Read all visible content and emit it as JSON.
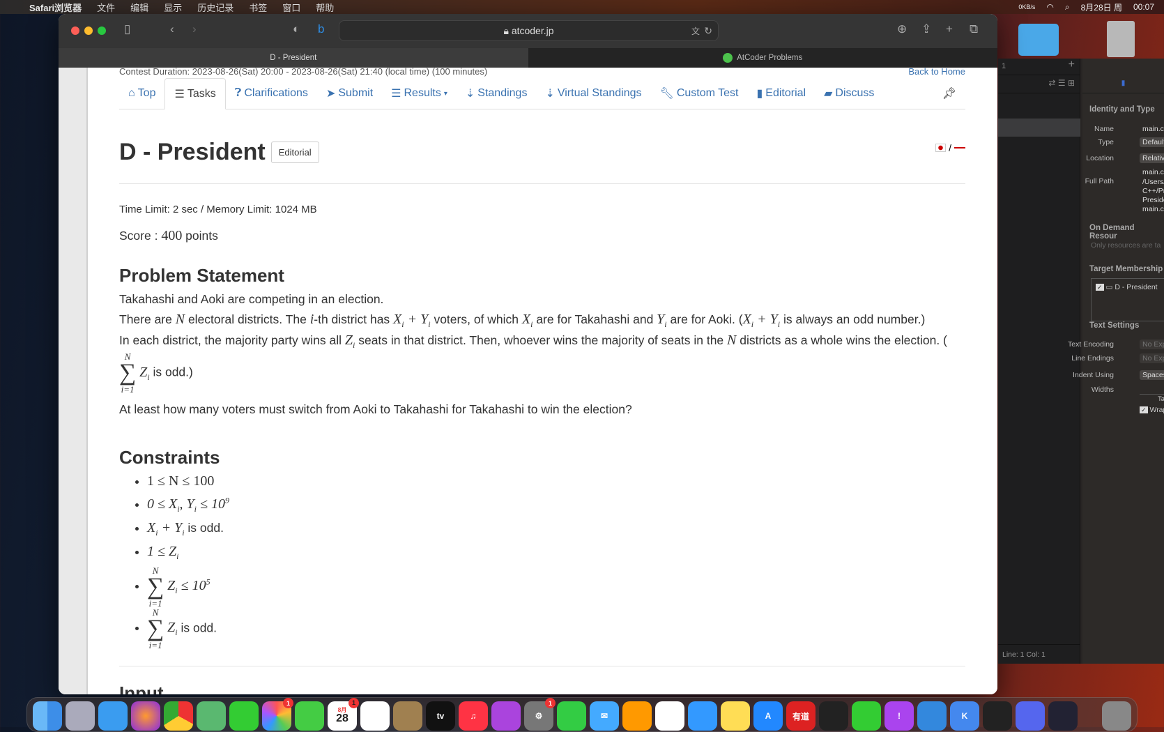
{
  "menubar": {
    "app": "Safari浏览器",
    "items": [
      "文件",
      "编辑",
      "显示",
      "历史记录",
      "书签",
      "窗口",
      "帮助"
    ],
    "net": "0KB/s",
    "date": "8月28日 周",
    "time": "00:07"
  },
  "browser": {
    "url": "atcoder.jp",
    "tabs": [
      {
        "title": "D - President",
        "active": true
      },
      {
        "title": "AtCoder Problems",
        "active": false
      }
    ]
  },
  "page": {
    "contest_duration": "Contest Duration: 2023-08-26(Sat) 20:00 - 2023-08-26(Sat) 21:40 (local time) (100 minutes)",
    "back_home": "Back to Home",
    "nav": [
      {
        "label": "Top",
        "icon": "home-icon"
      },
      {
        "label": "Tasks",
        "icon": "tasks-icon",
        "active": true
      },
      {
        "label": "Clarifications",
        "icon": "question-icon"
      },
      {
        "label": "Submit",
        "icon": "send-icon"
      },
      {
        "label": "Results",
        "icon": "list-icon",
        "dropdown": true
      },
      {
        "label": "Standings",
        "icon": "sort-icon"
      },
      {
        "label": "Virtual Standings",
        "icon": "sort-icon"
      },
      {
        "label": "Custom Test",
        "icon": "wrench-icon"
      },
      {
        "label": "Editorial",
        "icon": "book-icon"
      },
      {
        "label": "Discuss",
        "icon": "comment-icon"
      }
    ],
    "title": "D - President",
    "editorial_btn": "Editorial",
    "lang_sep": "/",
    "limits": "Time Limit: 2 sec / Memory Limit: 1024 MB",
    "score_label": "Score : ",
    "score": "400",
    "score_unit": " points",
    "ps_heading": "Problem Statement",
    "p1": "Takahashi and Aoki are competing in an election.",
    "p2": {
      "a": "There are ",
      "b": " electoral districts. The ",
      "c": "-th district has ",
      "d": " voters, of which ",
      "e": " are for Takahashi and ",
      "f": " are for Aoki. (",
      "g": " is always an odd number.)"
    },
    "p3": {
      "a": "In each district, the majority party wins all ",
      "b": " seats in that district. Then, whoever wins the majority of seats in the ",
      "c": " districts as a whole wins the election. (",
      "d": " is odd.)"
    },
    "p4": "At least how many voters must switch from Aoki to Takahashi for Takahashi to win the election?",
    "c_heading": "Constraints",
    "constraints": {
      "c1": "1 ≤ N ≤ 100",
      "c2a": "0 ≤ X",
      "c2b": ", Y",
      "c2c": " ≤ 10",
      "c2exp": "9",
      "c3": " is odd.",
      "c4": "1 ≤ Z",
      "c5": " ≤ 10",
      "c5exp": "5",
      "c6": " is odd."
    },
    "input_heading": "Input"
  },
  "xcode": {
    "header": "Identity and Type",
    "name_l": "Name",
    "name_v": "main.cpp",
    "type_l": "Type",
    "type_v": "Default",
    "loc_l": "Location",
    "loc_v": "Relative",
    "loc_file": "main.cpp",
    "fp_l": "Full Path",
    "fp_v": [
      "/Users/",
      "C++/Pr",
      "Preside",
      "main.cp"
    ],
    "odr": "On Demand Resour",
    "odr_ph": "Only resources are ta",
    "tm": "Target Membership",
    "tm_item": "D - President",
    "ts": "Text Settings",
    "enc_l": "Text Encoding",
    "enc_v": "No Explicit",
    "le_l": "Line Endings",
    "le_v": "No Explicit",
    "ind_l": "Indent Using",
    "ind_v": "Spaces",
    "w_l": "Widths",
    "tab": "Tab",
    "wrap": "Wrap lines",
    "status": "Line: 1  Col: 1",
    "tab_num": "1"
  },
  "dock": {
    "calendar_month": "8月",
    "calendar_day": "28",
    "tv": "tv",
    "youdao": "有道",
    "k": "K",
    "badges": "1"
  }
}
